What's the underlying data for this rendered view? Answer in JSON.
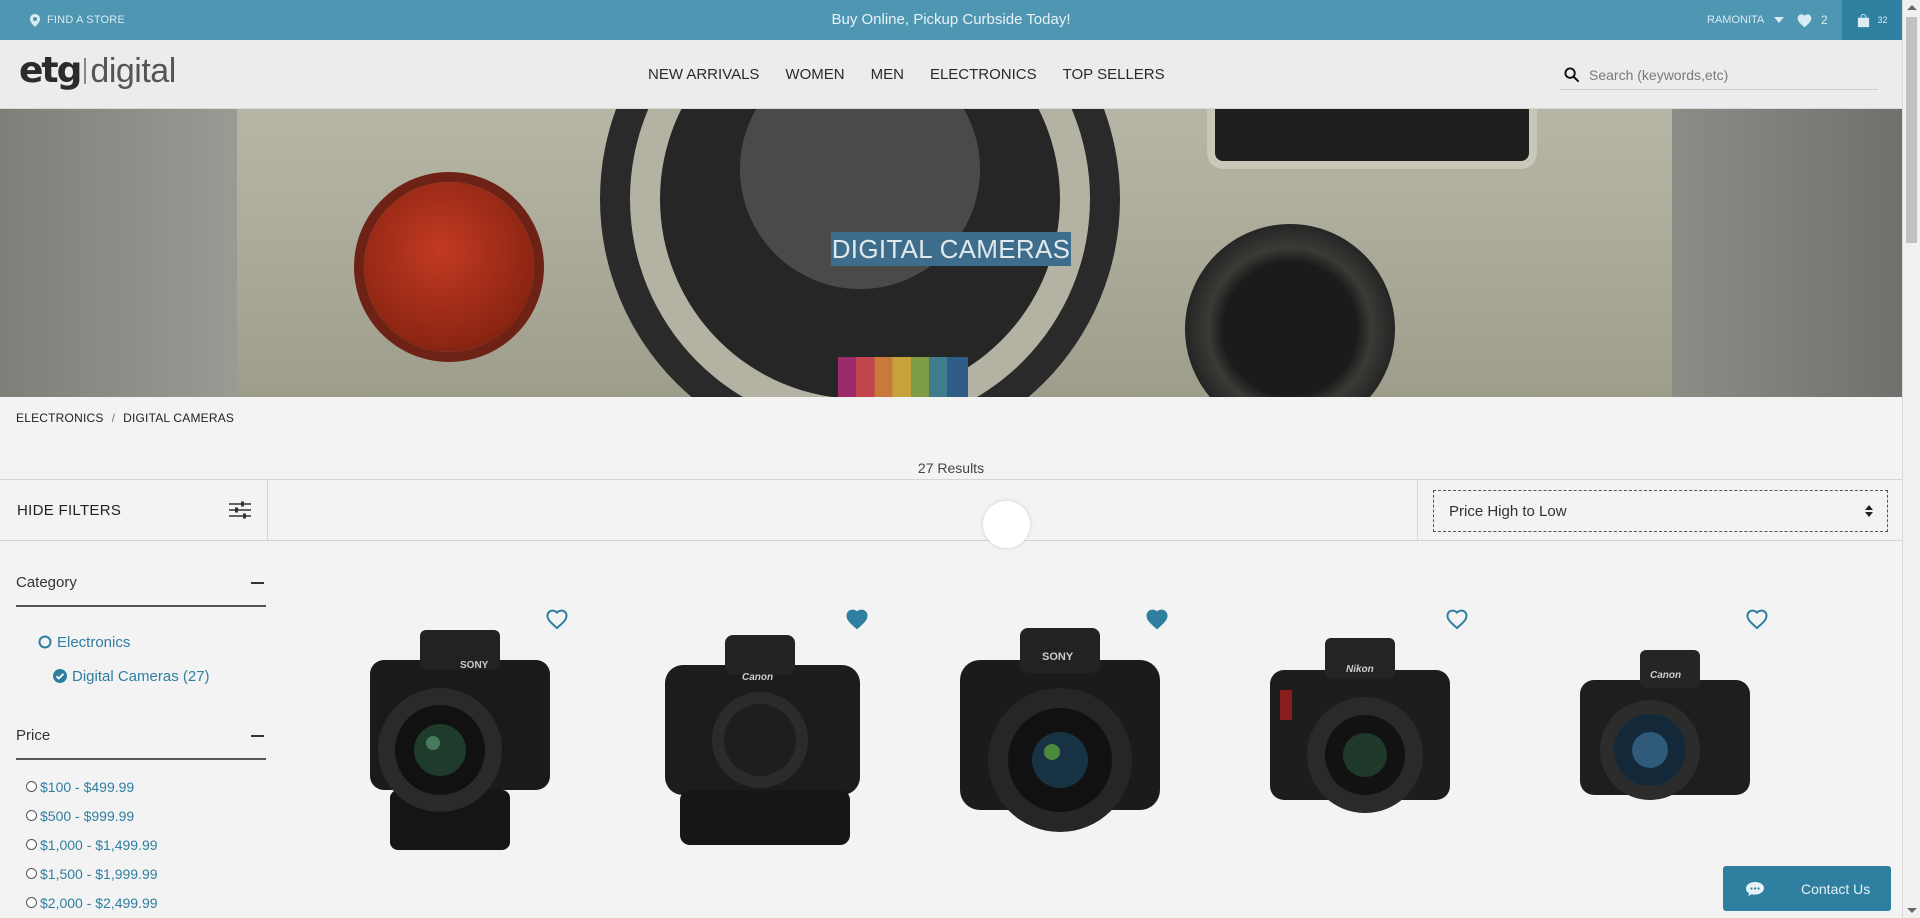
{
  "topbar": {
    "find_store": "FIND A STORE",
    "promo": "Buy Online, Pickup Curbside Today!",
    "username": "RAMONITA",
    "wishlist_count": "2",
    "cart_count": "32",
    "color": "#4f96b3"
  },
  "header": {
    "logo_main": "etg",
    "logo_sub": "digital",
    "nav": [
      "NEW ARRIVALS",
      "WOMEN",
      "MEN",
      "ELECTRONICS",
      "TOP SELLERS"
    ],
    "search_placeholder": "Search (keywords,etc)"
  },
  "hero": {
    "title": "DIGITAL CAMERAS"
  },
  "breadcrumb": [
    "ELECTRONICS",
    "DIGITAL CAMERAS"
  ],
  "results": "27 Results",
  "filters": {
    "toggle_label": "HIDE FILTERS",
    "sort_selected": "Price High to Low",
    "category": {
      "title": "Category",
      "items": [
        {
          "label": "Electronics",
          "checked": false
        },
        {
          "label": "Digital Cameras (27)",
          "checked": true
        }
      ]
    },
    "price": {
      "title": "Price",
      "items": [
        "$100 - $499.99",
        "$500 - $999.99",
        "$1,000 - $1,499.99",
        "$1,500 - $1,999.99",
        "$2,000 - $2,499.99"
      ]
    }
  },
  "products": [
    {
      "brand": "SONY",
      "favorited": false
    },
    {
      "brand": "Canon",
      "favorited": true
    },
    {
      "brand": "SONY",
      "favorited": true
    },
    {
      "brand": "Nikon",
      "favorited": false
    },
    {
      "brand": "Canon",
      "favorited": false
    }
  ],
  "contact": {
    "label": "Contact Us"
  },
  "colors": {
    "accent": "#2f7fa0",
    "link": "#2f7fa0"
  }
}
